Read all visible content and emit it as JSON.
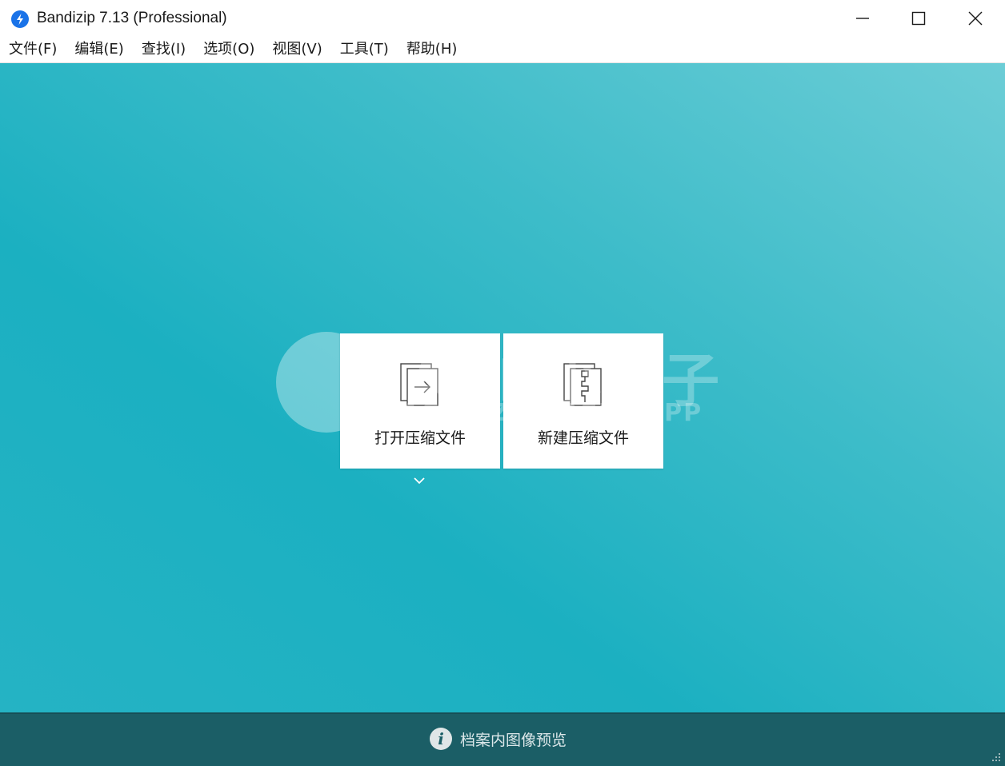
{
  "window": {
    "title": "Bandizip 7.13 (Professional)",
    "icon": "bandizip-logo-icon",
    "controls": [
      "minimize-icon",
      "maximize-icon",
      "close-icon"
    ]
  },
  "menu": {
    "items": [
      {
        "label": "文件(F)"
      },
      {
        "label": "编辑(E)"
      },
      {
        "label": "查找(I)"
      },
      {
        "label": "选项(O)"
      },
      {
        "label": "视图(V)"
      },
      {
        "label": "工具(T)"
      },
      {
        "label": "帮助(H)"
      }
    ]
  },
  "main": {
    "cards": [
      {
        "label": "打开压缩文件",
        "icon": "open-archive-icon"
      },
      {
        "label": "新建压缩文件",
        "icon": "new-archive-icon"
      }
    ],
    "open_dropdown_icon": "chevron-down-icon"
  },
  "watermark": {
    "big": "JACK小桔子",
    "small": "JACKXJZ.VERCEL.APP"
  },
  "status": {
    "text": "档案内图像预览",
    "icon": "info-icon"
  },
  "colors": {
    "accent": "#1bb0c1",
    "status_bar": "#1b5e66"
  }
}
